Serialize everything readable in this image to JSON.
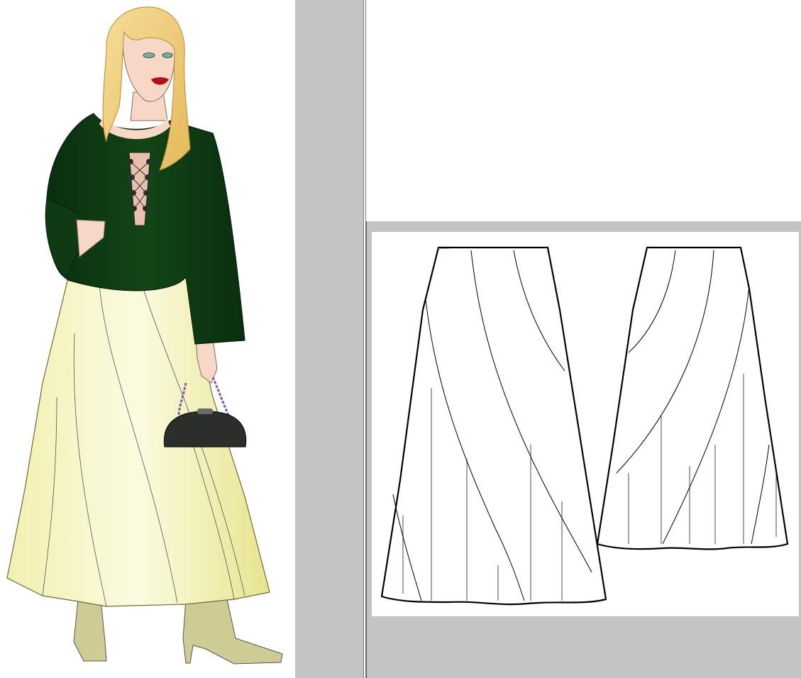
{
  "colors": {
    "blouse": "#0d3812",
    "skirt": "#f6f5c2",
    "skirt_shade": "#e9e69a",
    "hair": "#f1d27f",
    "skin": "#f7d7c6",
    "boots": "#cfcb95",
    "bag": "#2b2e2a",
    "background_gray": "#c3c3c3"
  },
  "figure": {
    "pieces": [
      "fashion-illustration",
      "front-view-skirt-sketch",
      "back-view-skirt-sketch"
    ]
  }
}
